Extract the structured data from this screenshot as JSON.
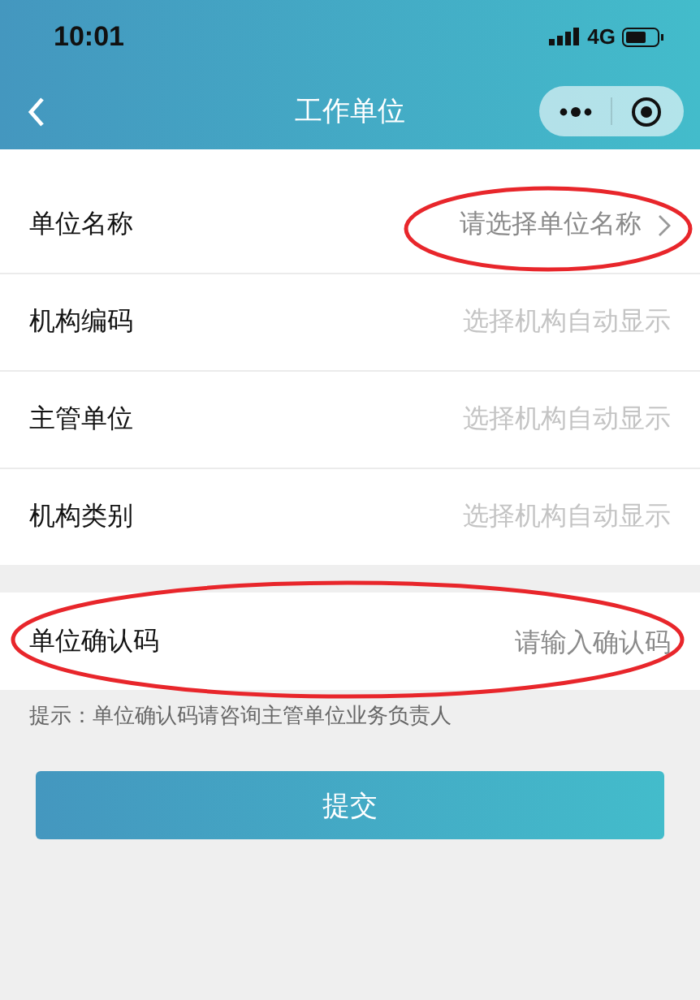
{
  "status_bar": {
    "time": "10:01",
    "network": "4G"
  },
  "nav_bar": {
    "title": "工作单位"
  },
  "form_groups": [
    {
      "rows": [
        {
          "kind": "select",
          "label": "单位名称",
          "placeholder": "请选择单位名称",
          "highlighted": true
        },
        {
          "kind": "auto",
          "label": "机构编码",
          "placeholder": "选择机构自动显示",
          "highlighted": false
        },
        {
          "kind": "auto",
          "label": "主管单位",
          "placeholder": "选择机构自动显示",
          "highlighted": false
        },
        {
          "kind": "auto",
          "label": "机构类别",
          "placeholder": "选择机构自动显示",
          "highlighted": false
        }
      ]
    },
    {
      "rows": [
        {
          "kind": "input",
          "label": "单位确认码",
          "placeholder": "请输入确认码",
          "highlighted": true
        }
      ]
    }
  ],
  "hint": "提示：单位确认码请咨询主管单位业务负责人",
  "submit_button": "提交"
}
